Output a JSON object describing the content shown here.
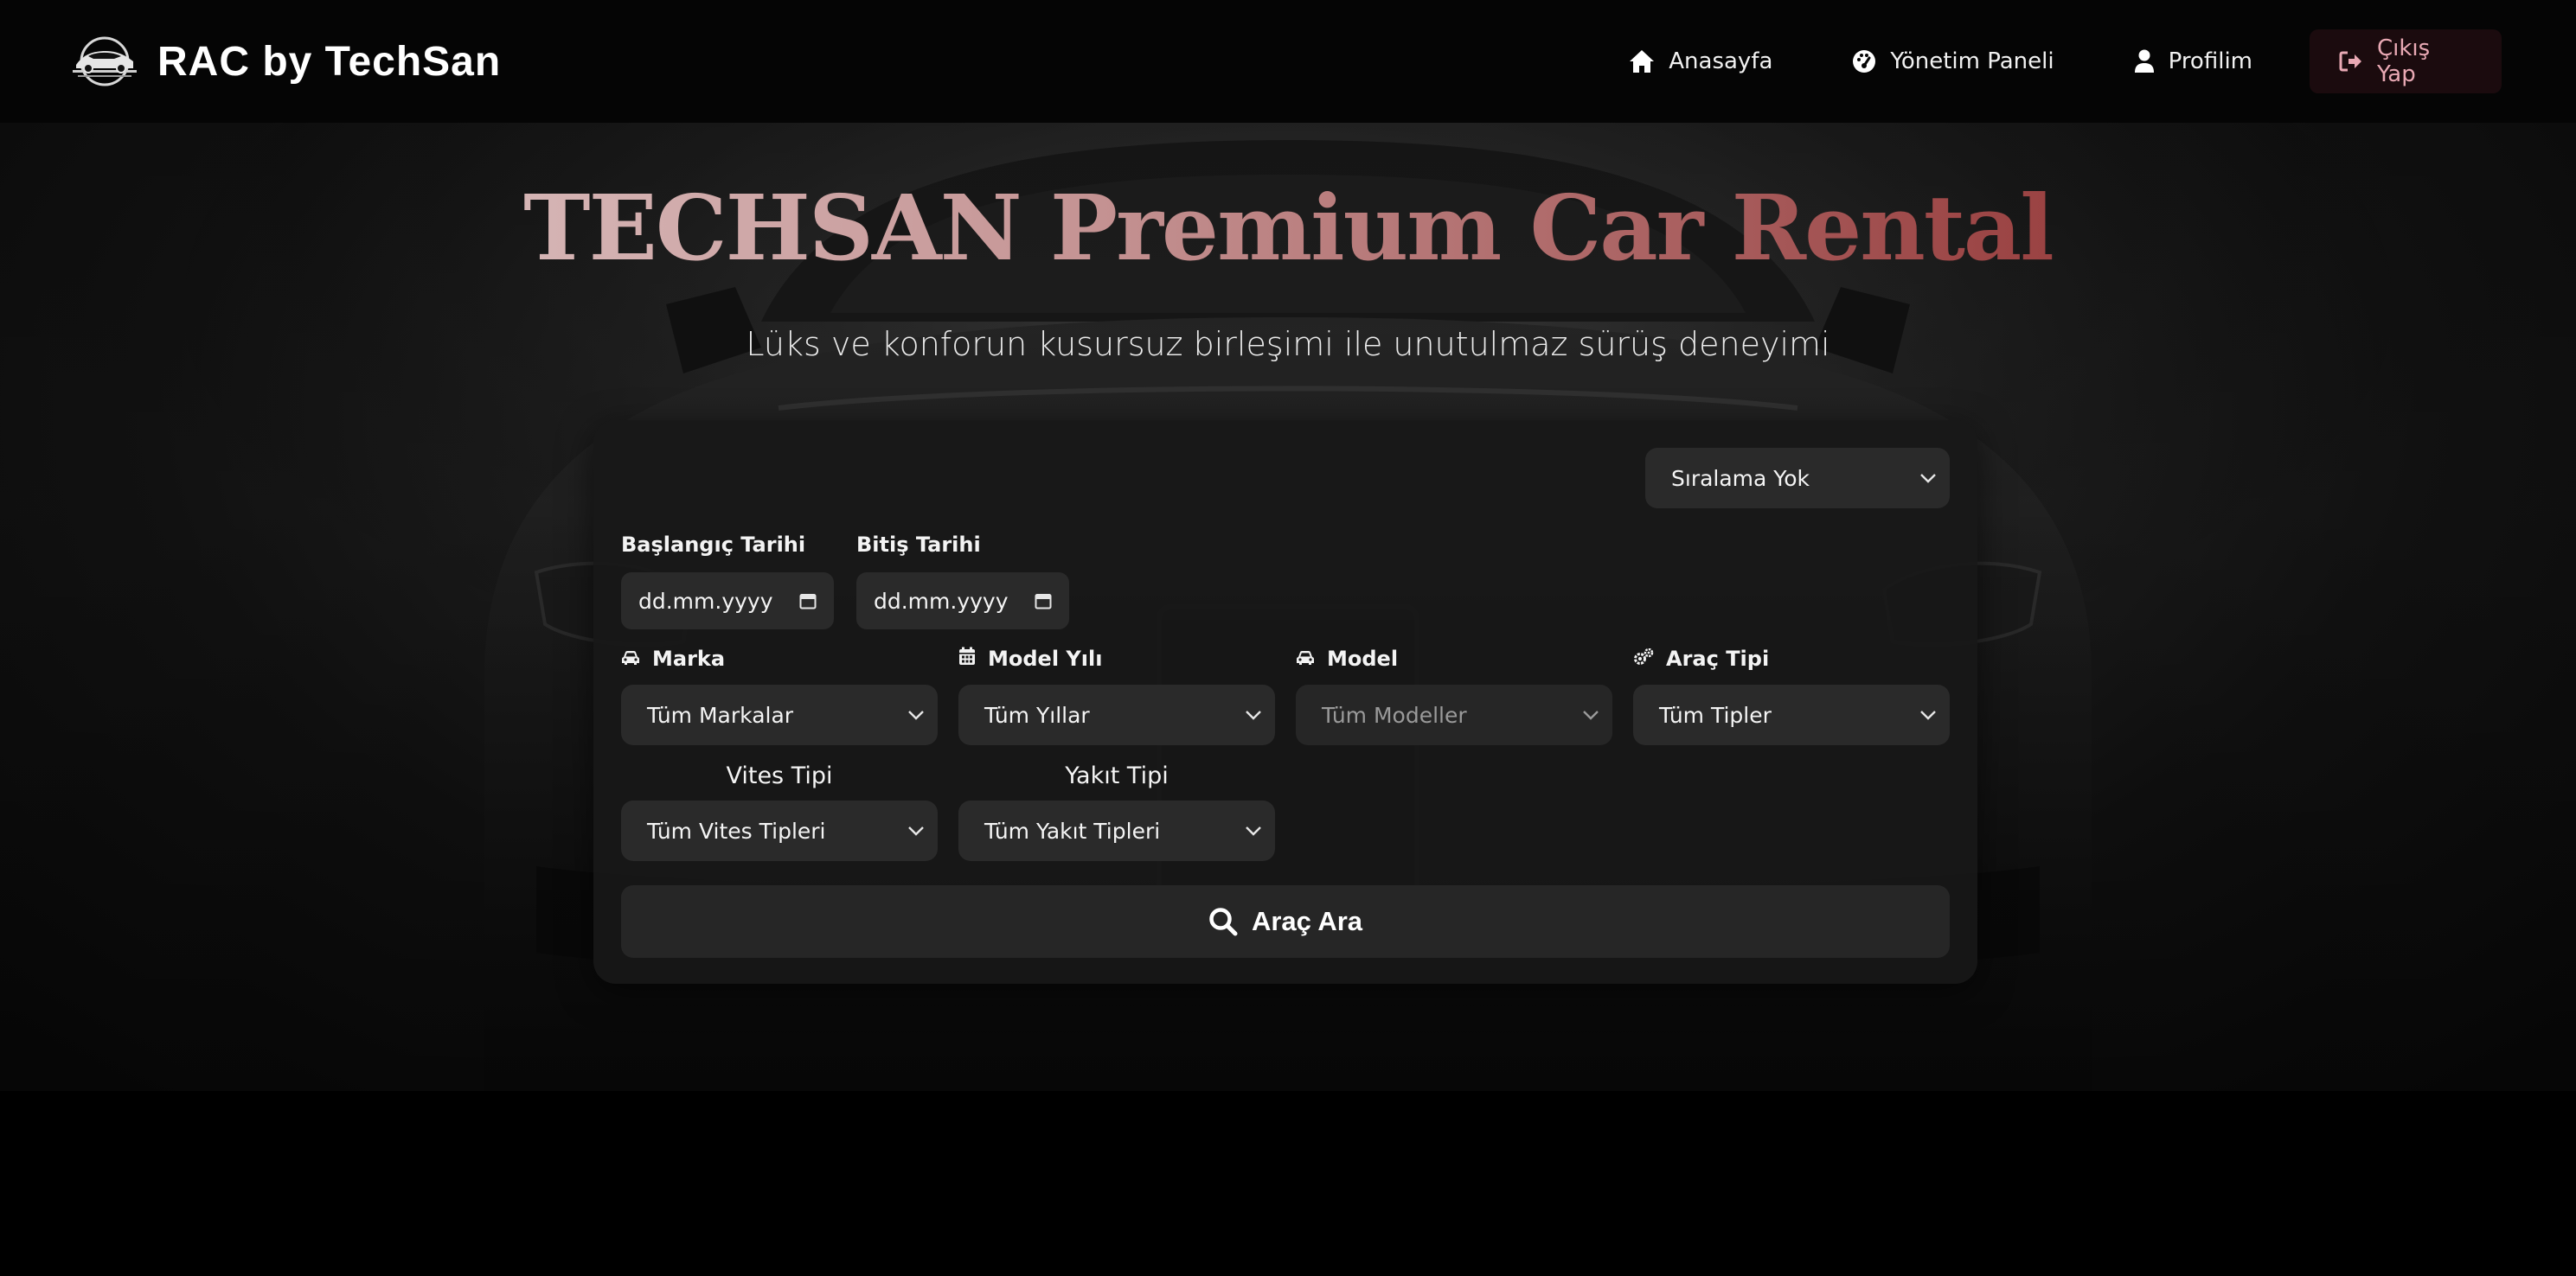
{
  "nav": {
    "brand": "RAC by TechSan",
    "links": [
      {
        "label": "Anasayfa",
        "icon": "home-icon"
      },
      {
        "label": "Yönetim Paneli",
        "icon": "dashboard-icon"
      },
      {
        "label": "Profilim",
        "icon": "user-icon"
      }
    ],
    "logout": {
      "label": "Çıkış Yap",
      "icon": "logout-icon"
    }
  },
  "hero": {
    "title": "TECHSAN Premium Car Rental",
    "subtitle": "Lüks ve konforun kusursuz birleşimi ile unutulmaz sürüş deneyimi"
  },
  "search": {
    "sort": {
      "value": "Sıralama Yok"
    },
    "start_date": {
      "label": "Başlangıç Tarihi",
      "placeholder": "dd.mm.yyyy"
    },
    "end_date": {
      "label": "Bitiş Tarihi",
      "placeholder": "dd.mm.yyyy"
    },
    "brand": {
      "label": "Marka",
      "value": "Tüm Markalar",
      "icon": "car-icon"
    },
    "model_year": {
      "label": "Model Yılı",
      "value": "Tüm Yıllar",
      "icon": "calendar-icon"
    },
    "model": {
      "label": "Model",
      "value": "Tüm Modeller",
      "icon": "car-icon",
      "disabled": true
    },
    "vehicle_type": {
      "label": "Araç Tipi",
      "value": "Tüm Tipler",
      "icon": "gears-icon"
    },
    "transmission": {
      "label": "Vites Tipi",
      "value": "Tüm Vites Tipleri"
    },
    "fuel": {
      "label": "Yakıt Tipi",
      "value": "Tüm Yakıt Tipleri"
    },
    "submit": {
      "label": "Araç Ara",
      "icon": "search-icon"
    }
  },
  "colors": {
    "background": "#000000",
    "panel": "#181818",
    "input": "#2a2a2a",
    "logout_text": "#e9a9b4",
    "title_gradient_start": "#e4d2d2",
    "title_gradient_end": "#8a2222"
  }
}
